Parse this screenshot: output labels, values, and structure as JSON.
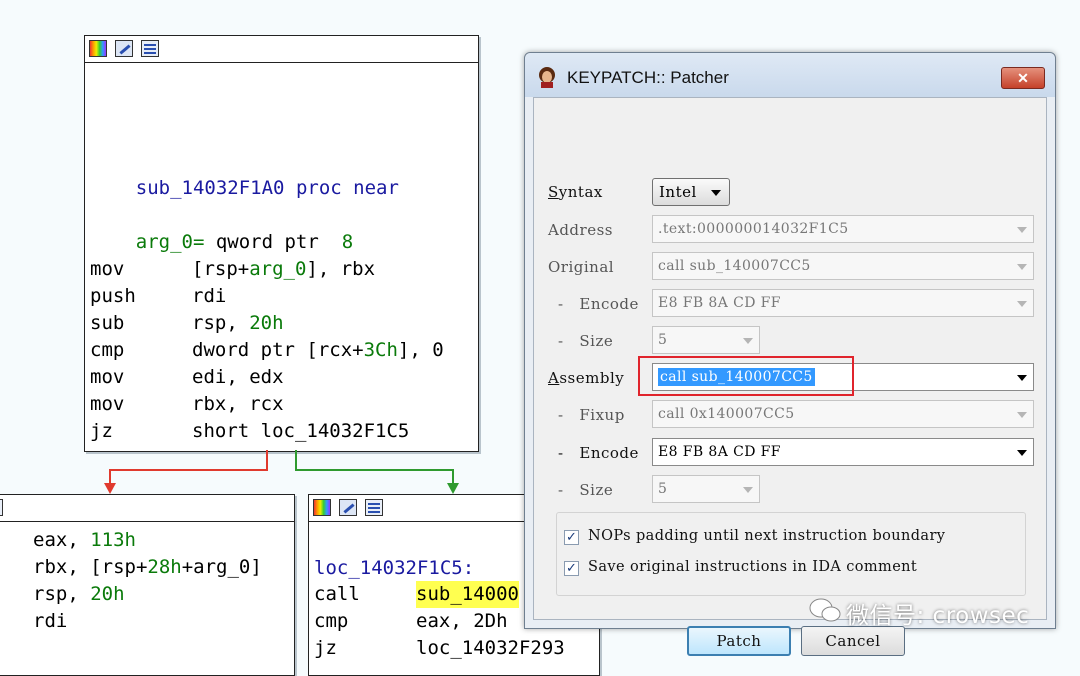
{
  "graph": {
    "main_block": {
      "proc_line": [
        "sub_14032F1A0",
        "proc near"
      ],
      "arg_line": [
        "arg_0=",
        "qword ptr",
        "8"
      ],
      "instructions": [
        {
          "mnem": "mov",
          "a": "[rsp+",
          "b": "arg_0",
          "c": "], rbx"
        },
        {
          "mnem": "push",
          "a": "rdi",
          "b": "",
          "c": ""
        },
        {
          "mnem": "sub",
          "a": "rsp, ",
          "b": "20h",
          "c": ""
        },
        {
          "mnem": "cmp",
          "a": "dword ptr [rcx+",
          "b": "3Ch",
          "c": "], 0"
        },
        {
          "mnem": "mov",
          "a": "edi, edx",
          "b": "",
          "c": ""
        },
        {
          "mnem": "mov",
          "a": "rbx, rcx",
          "b": "",
          "c": ""
        },
        {
          "mnem": "jz",
          "a": "short loc_14032F1C5",
          "b": "",
          "c": ""
        }
      ]
    },
    "left_block": {
      "lines": [
        {
          "a": "eax, ",
          "b": "113h",
          "c": ""
        },
        {
          "a": "rbx, [rsp+",
          "b": "28h",
          "c": "+arg_0]"
        },
        {
          "a": "rsp, ",
          "b": "20h",
          "c": ""
        },
        {
          "a": "rdi",
          "b": "",
          "c": ""
        }
      ]
    },
    "right_block": {
      "label": "loc_14032F1C5:",
      "call_mnem": "call",
      "call_target": "sub_14000",
      "cmp_mnem": "cmp",
      "cmp_ops": "eax, 2Dh",
      "jz_mnem": "jz",
      "jz_target": "loc_14032F293"
    }
  },
  "dialog": {
    "title": "KEYPATCH:: Patcher",
    "close_label": "✕",
    "syntax": {
      "label_u": "S",
      "label_rest": "yntax",
      "value": "Intel"
    },
    "address": {
      "label": "Address",
      "value": ".text:000000014032F1C5"
    },
    "original": {
      "label": "Original",
      "value": "call sub_140007CC5"
    },
    "orig_encode": {
      "label": "-   Encode",
      "value": "E8 FB 8A CD FF"
    },
    "orig_size": {
      "label": "-   Size",
      "value": "5"
    },
    "assembly": {
      "label_u": "A",
      "label_rest": "ssembly",
      "value": "call sub_140007CC5"
    },
    "fixup": {
      "label": "-   Fixup",
      "value": "call 0x140007CC5"
    },
    "new_encode": {
      "label": "-   Encode",
      "value": "E8 FB 8A CD FF"
    },
    "new_size": {
      "label": "-   Size",
      "value": "5"
    },
    "nops_label": "NOPs padding until next instruction boundary",
    "nops_checked": true,
    "save_label": "Save original instructions in IDA comment",
    "save_checked": true,
    "patch_label": "Patch",
    "cancel_label": "Cancel",
    "check_mark": "✓"
  },
  "watermark": "微信号: crowsec"
}
